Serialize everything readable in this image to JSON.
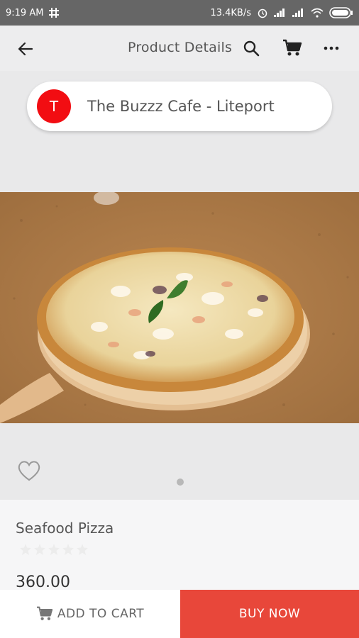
{
  "status_bar": {
    "time": "9:19 AM",
    "network_speed": "13.4KB/s",
    "icons": [
      "slack-icon",
      "alarm-icon",
      "signal-icon",
      "signal-icon",
      "wifi-icon",
      "battery-icon"
    ]
  },
  "app_bar": {
    "title": "Product Details",
    "icons": [
      "back-arrow-icon",
      "search-icon",
      "cart-icon",
      "more-icon"
    ]
  },
  "store": {
    "avatar_letter": "T",
    "avatar_color": "#f20d12",
    "name": "The Buzzz Cafe - Liteport"
  },
  "product": {
    "image_alt": "Seafood pizza on wooden board",
    "name": "Seafood Pizza",
    "rating": 0,
    "rating_max": 5,
    "price": "360.00",
    "carousel_active_index": 0,
    "carousel_count": 1
  },
  "actions": {
    "add_to_cart": "ADD TO CART",
    "buy_now": "BUY NOW"
  },
  "colors": {
    "accent": "#e8473a",
    "status_bar": "#666666"
  }
}
